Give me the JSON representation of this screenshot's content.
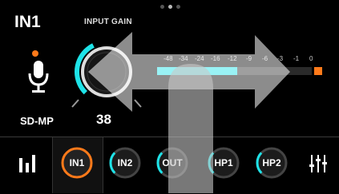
{
  "channel": {
    "name": "IN1",
    "device": "SD-MP"
  },
  "gain": {
    "label": "INPUT GAIN",
    "value": "38",
    "level": 0.38
  },
  "meter": {
    "scale": [
      "-48",
      "-34",
      "-24",
      "-16",
      "-12",
      "-9",
      "-6",
      "-3",
      "-1",
      "0"
    ],
    "level_db": "-16"
  },
  "tabs": [
    {
      "label": "IN1",
      "active": true
    },
    {
      "label": "IN2",
      "active": false
    },
    {
      "label": "OUT",
      "active": false
    },
    {
      "label": "HP1",
      "active": false
    },
    {
      "label": "HP2",
      "active": false
    }
  ],
  "icons": {
    "meters": "bar-meter-icon",
    "mixer": "mixer-sliders-icon",
    "mic": "microphone-icon"
  },
  "colors": {
    "accent_cyan": "#1ee3e8",
    "accent_orange": "#ff7a1a",
    "bg": "#000000"
  },
  "pager": {
    "pages": 3,
    "current": 2
  }
}
